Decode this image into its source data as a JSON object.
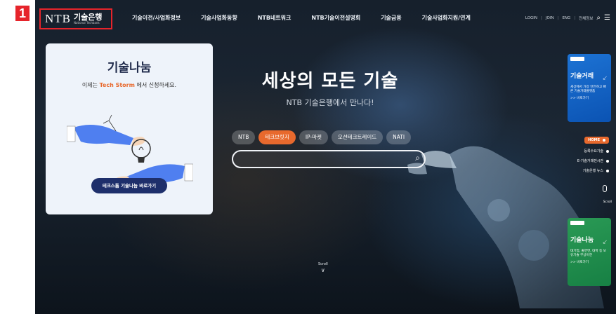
{
  "annotation": {
    "badge": "1"
  },
  "header": {
    "logo": {
      "ntb": "NTB",
      "ko": "기술은행",
      "sub": "National Techbank"
    },
    "menu": [
      "기술이전/사업화정보",
      "기술사업화동향",
      "NTB네트워크",
      "NTB기술이전설명회",
      "기술금융",
      "기술사업화지원/연계"
    ],
    "util": [
      "LOGIN",
      "JOIN",
      "ENG",
      "전체정보"
    ]
  },
  "card": {
    "title": "기술나눔",
    "sub_prefix": "이제는 ",
    "sub_highlight": "Tech Storm",
    "sub_suffix": " 에서 신청하세요.",
    "button": "테크스톰 기술나눔 바로가기"
  },
  "hero": {
    "title": "세상의 모든 기술",
    "subtitle": "NTB 기술은행에서 만나다!",
    "pills": [
      "NTB",
      "테크브릿지",
      "IP-마켓",
      "오션테크트레이드",
      "NATI"
    ],
    "active_pill": "테크브릿지",
    "scroll": "Scroll"
  },
  "right": {
    "banner_top": {
      "head": "기술거래",
      "desc": "세상에서 가장 안전하고 빠른 기술거래플랫폼",
      "go": ">> 바로가기"
    },
    "quick": [
      "HOME",
      "등록수요기술",
      "E-기술거래전시관",
      "기술은행 뉴스"
    ],
    "scroll": "Scroll",
    "banner_bot": {
      "head": "기술나눔",
      "desc": "대기업, 출연연, 대학 등 보유기술 무상이전",
      "go": ">> 바로가기"
    }
  },
  "colors": {
    "accent": "#e8692d",
    "navy": "#1e2f6b",
    "annotation": "#e6242b"
  }
}
